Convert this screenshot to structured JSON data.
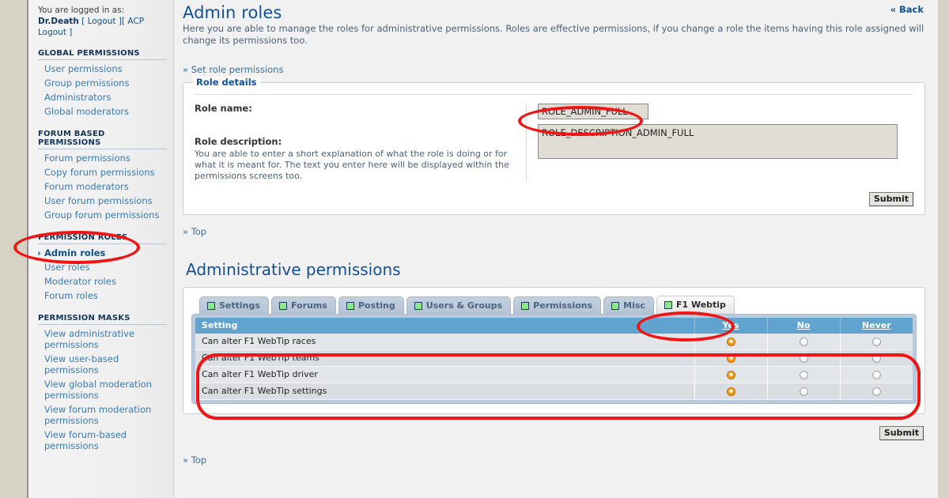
{
  "sidebar": {
    "logged_in_label": "You are logged in as:",
    "username": "Dr.Death",
    "logout_label": "[ Logout ]",
    "acp_logout_label": "[ ACP Logout ]",
    "groups": [
      {
        "heading": "GLOBAL PERMISSIONS",
        "items": [
          {
            "label": "User permissions",
            "active": false
          },
          {
            "label": "Group permissions",
            "active": false
          },
          {
            "label": "Administrators",
            "active": false
          },
          {
            "label": "Global moderators",
            "active": false
          }
        ]
      },
      {
        "heading": "FORUM BASED PERMISSIONS",
        "items": [
          {
            "label": "Forum permissions",
            "active": false
          },
          {
            "label": "Copy forum permissions",
            "active": false
          },
          {
            "label": "Forum moderators",
            "active": false
          },
          {
            "label": "User forum permissions",
            "active": false
          },
          {
            "label": "Group forum permissions",
            "active": false
          }
        ]
      },
      {
        "heading": "PERMISSION ROLES",
        "items": [
          {
            "label": "Admin roles",
            "active": true
          },
          {
            "label": "User roles",
            "active": false
          },
          {
            "label": "Moderator roles",
            "active": false
          },
          {
            "label": "Forum roles",
            "active": false
          }
        ]
      },
      {
        "heading": "PERMISSION MASKS",
        "items": [
          {
            "label": "View administrative permissions",
            "active": false
          },
          {
            "label": "View user-based permissions",
            "active": false
          },
          {
            "label": "View global moderation permissions",
            "active": false
          },
          {
            "label": "View forum moderation permissions",
            "active": false
          },
          {
            "label": "View forum-based permissions",
            "active": false
          }
        ]
      }
    ]
  },
  "main": {
    "back_link": "« Back",
    "title": "Admin roles",
    "description": "Here you are able to manage the roles for administrative permissions. Roles are effective permissions, if you change a role the items having this role assigned will change its permissions too.",
    "set_role_permissions_link": "» Set role permissions",
    "top_link_1": "» Top",
    "top_link_2": "» Top"
  },
  "role_details": {
    "legend": "Role details",
    "role_name_label": "Role name:",
    "role_name_value": "ROLE_ADMIN_FULL",
    "role_description_label": "Role description:",
    "role_description_help": "You are able to enter a short explanation of what the role is doing or for what it is meant for. The text you enter here will be displayed within the permissions screens too.",
    "role_description_value": "ROLE_DESCRIPTION_ADMIN_FULL",
    "submit_label": "Submit"
  },
  "permissions": {
    "section_title": "Administrative permissions",
    "tabs": [
      {
        "label": "Settings",
        "active": false
      },
      {
        "label": "Forums",
        "active": false
      },
      {
        "label": "Posting",
        "active": false
      },
      {
        "label": "Users & Groups",
        "active": false
      },
      {
        "label": "Permissions",
        "active": false
      },
      {
        "label": "Misc",
        "active": false
      },
      {
        "label": "F1 Webtip",
        "active": true
      }
    ],
    "columns": [
      "Setting",
      "Yes",
      "No",
      "Never"
    ],
    "rows": [
      {
        "setting": "Can alter F1 WebTip races",
        "value": "Yes"
      },
      {
        "setting": "Can alter F1 WebTip teams",
        "value": "Yes"
      },
      {
        "setting": "Can alter F1 WebTip driver",
        "value": "Yes"
      },
      {
        "setting": "Can alter F1 WebTip settings",
        "value": "Yes"
      }
    ],
    "submit_label": "Submit"
  },
  "annotation": {
    "color": "#f01414"
  }
}
